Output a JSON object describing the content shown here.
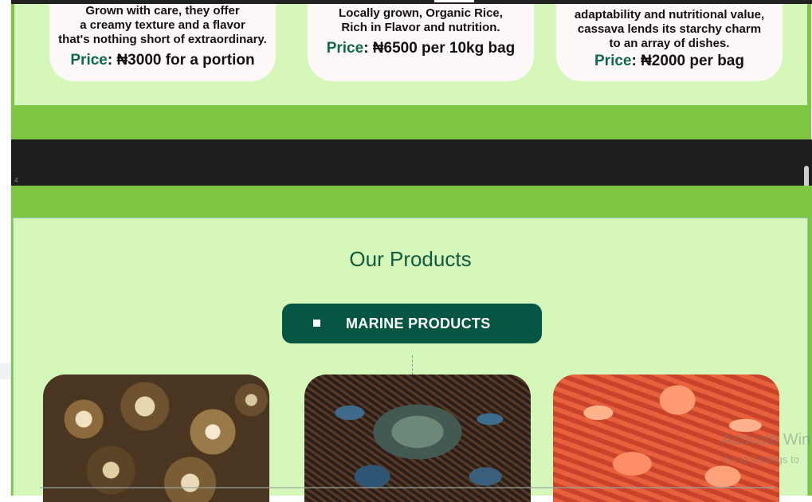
{
  "featured": [
    {
      "desc_lines": [
        "Grown with care, they offer",
        "a creamy texture and a flavor",
        "that's nothing short of extraordinary."
      ],
      "price_label": "Price",
      "price_value": ": ₦3000 for a portion"
    },
    {
      "desc_lines": [
        "Locally grown, Organic Rice,",
        "Rich in Flavor and nutrition."
      ],
      "price_label": "Price",
      "price_value": ": ₦6500 per 10kg bag"
    },
    {
      "desc_lines": [
        "adaptability and nutritional value,",
        "cassava lends its starchy charm",
        "to an array of dishes."
      ],
      "price_label": "Price",
      "price_value": ": ₦2000 per bag"
    }
  ],
  "page_marker": "4",
  "products": {
    "title": "Our Products",
    "category_button": "MARINE PRODUCTS",
    "images": [
      {
        "name": "periwinkle-snails-photo"
      },
      {
        "name": "crab-photo"
      },
      {
        "name": "shrimp-photo"
      }
    ]
  },
  "watermark": {
    "line1": "Activate Win",
    "line2": "Go to Settings to"
  },
  "colors": {
    "page_green": "#7dc542",
    "panel_green": "#d5f7b9",
    "brand_dark": "#055543",
    "price_label": "#0d6a47"
  }
}
